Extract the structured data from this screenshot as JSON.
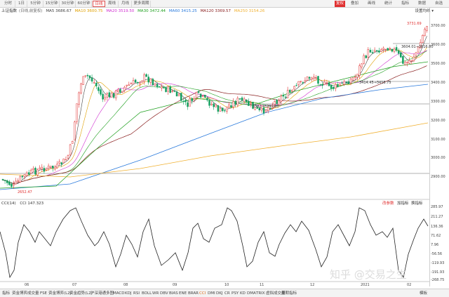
{
  "period_tabs": [
    "分时",
    "1日",
    "5分钟",
    "15分钟",
    "30分钟",
    "60分钟",
    "日线",
    "周线",
    "月线",
    "更多周期"
  ],
  "active_period": "日线",
  "right_tabs": [
    "复权",
    "叠加",
    "画线",
    "统计",
    "指标",
    "数据",
    "自选"
  ],
  "active_right_tab": "复权",
  "ma_legend": {
    "name": "上证指数",
    "period": "(日线,前复权)",
    "ma5": "MA5 3686.67",
    "ma10": "MA10 3600.75",
    "ma20": "MA20 3519.50",
    "ma30": "MA30 3472.44",
    "ma60": "MA60 3415.25",
    "ma120": "MA120 3369.57",
    "ma250": "MA250 3154.26"
  },
  "settings_label": "设置均线",
  "colors": {
    "up": "#e03030",
    "down": "#14a060",
    "ma5": "#444444",
    "ma10": "#e0a000",
    "ma20": "#d030d0",
    "ma30": "#20a020",
    "ma60": "#2a7adc",
    "ma120": "#8a2020",
    "ma250": "#f0b030",
    "cci": "#222222"
  },
  "price_axis": [
    "3700.00",
    "3600.00",
    "3500.00",
    "3400.00",
    "3300.00",
    "3200.00",
    "3100.00",
    "3000.00",
    "2900.00"
  ],
  "price_annotations": {
    "high": "3731.69",
    "low": "2652.47",
    "level1": "3604.01→3616.80",
    "level2": "3414.45→3418.75",
    "level3": "3382→3291.60"
  },
  "cci": {
    "label": "CCI(14)",
    "value": "CCI 147.323",
    "btn_params": "改参数",
    "btn_add": "加指标",
    "btn_switch": "换指标",
    "axis": [
      "285.97",
      "211.27",
      "136.36",
      "71.62",
      "7.96",
      "-56.56",
      "-119.93",
      "-191.93",
      "-268.75"
    ]
  },
  "date_axis": [
    "06",
    "07",
    "08",
    "09",
    "10",
    "11",
    "12",
    "2021",
    "02"
  ],
  "indicator_tabs": [
    "指标",
    "资金博弈",
    "成交量",
    "FSE",
    "资金博弈(L2)",
    "资金趋势(L2)",
    "沪深港通多图",
    "MACD",
    "KDJ",
    "RSI",
    "BOLL",
    "WR",
    "DBV",
    "BIAS",
    "ENE",
    "BRAR",
    "CCI",
    "DMI",
    "DKJ",
    "CR",
    "PSY",
    "KD",
    "DMA",
    "TRIX",
    "虚拟成交量",
    "周期指标"
  ],
  "active_indicator": "CCI",
  "indicator_tab_right": "模板",
  "watermark": "知乎 @交易之生"
}
